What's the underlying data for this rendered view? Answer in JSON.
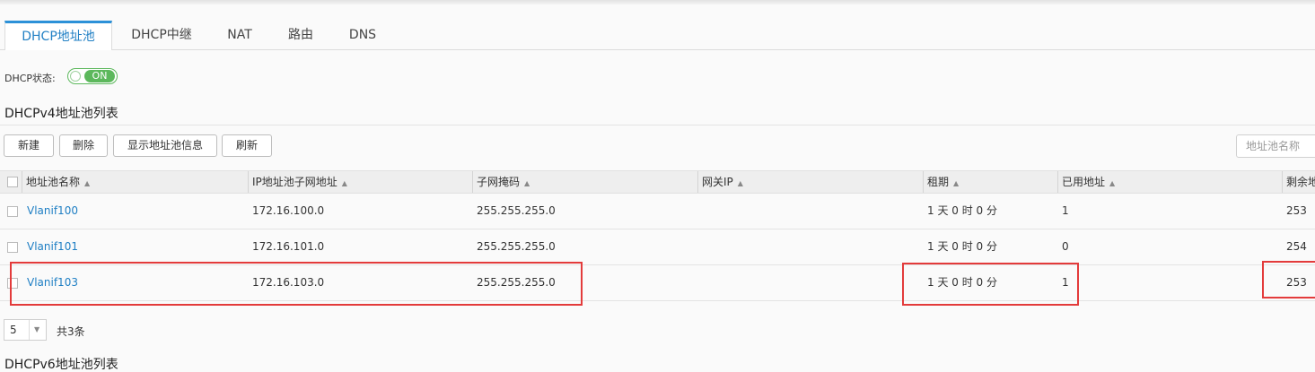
{
  "tabs": [
    "DHCP地址池",
    "DHCP中继",
    "NAT",
    "路由",
    "DNS"
  ],
  "dhcp_status": {
    "label": "DHCP状态:",
    "toggle": "ON"
  },
  "section_title": "DHCPv4地址池列表",
  "toolbar": {
    "new": "新建",
    "delete": "删除",
    "show_info": "显示地址池信息",
    "refresh": "刷新"
  },
  "search": {
    "placeholder": "地址池名称"
  },
  "table": {
    "columns": [
      "地址池名称",
      "IP地址池子网地址",
      "子网掩码",
      "网关IP",
      "租期",
      "已用地址",
      "剩余地"
    ],
    "sort_icon": "▲",
    "rows": [
      {
        "name": "Vlanif100",
        "subnet": "172.16.100.0",
        "mask": "255.255.255.0",
        "gateway": "",
        "lease": "1 天 0 时 0 分",
        "used": "1",
        "remaining": "253"
      },
      {
        "name": "Vlanif101",
        "subnet": "172.16.101.0",
        "mask": "255.255.255.0",
        "gateway": "",
        "lease": "1 天 0 时 0 分",
        "used": "0",
        "remaining": "254"
      },
      {
        "name": "Vlanif103",
        "subnet": "172.16.103.0",
        "mask": "255.255.255.0",
        "gateway": "",
        "lease": "1 天 0 时 0 分",
        "used": "1",
        "remaining": "253"
      }
    ]
  },
  "pager": {
    "page_size": "5",
    "arrow": "▼",
    "total": "共3条"
  },
  "section2_title": "DHCPv6地址池列表",
  "colors": {
    "accent": "#1f7fc4",
    "toggle_on": "#5cb85c",
    "highlight": "#e33b3b"
  }
}
